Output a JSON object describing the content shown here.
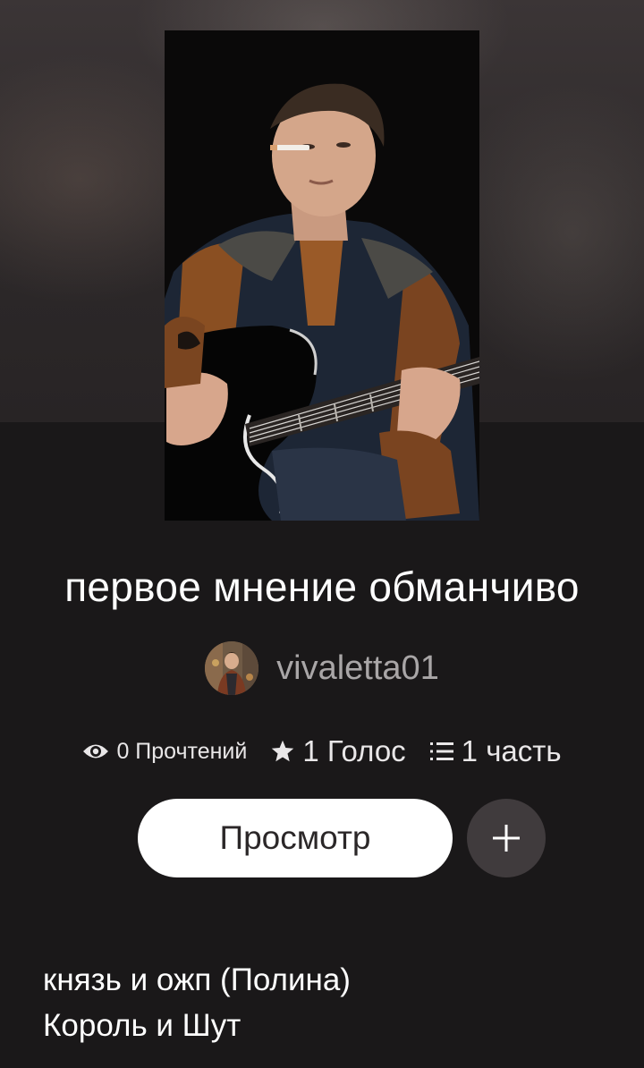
{
  "story": {
    "title": "первое мнение обманчиво",
    "author": "vivaletta01"
  },
  "stats": {
    "reads": "0 Прочтений",
    "votes": "1 Голос",
    "parts": "1 часть"
  },
  "actions": {
    "view_label": "Просмотр"
  },
  "tags": [
    "князь и ожп (Полина)",
    "Король и Шут"
  ],
  "icons": {
    "reads": "eye-icon",
    "votes": "star-icon",
    "parts": "list-icon",
    "add": "plus-icon"
  },
  "colors": {
    "background": "#1a1819",
    "button_bg": "#ffffff",
    "add_button_bg": "#403b3d",
    "author_text": "#a9a6a7"
  }
}
